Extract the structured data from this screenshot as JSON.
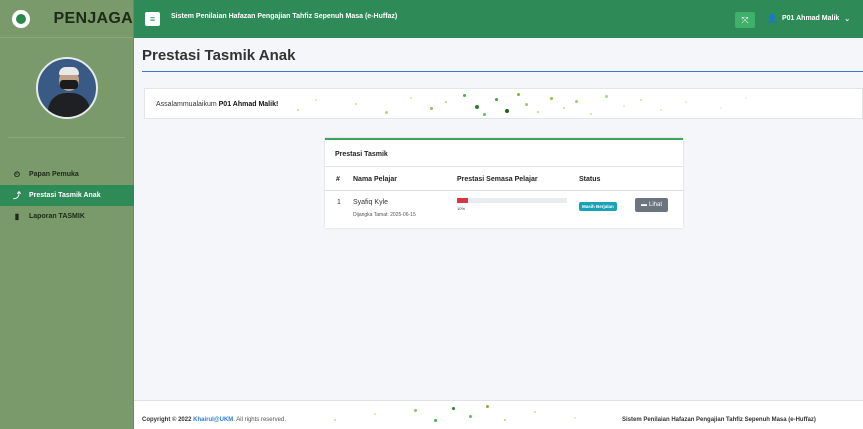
{
  "brand": {
    "name": "PENJAGA"
  },
  "sidebar": {
    "items": [
      {
        "label": "Papan Pemuka",
        "icon": "tachometer-icon",
        "glyph": "⏲",
        "active": false
      },
      {
        "label": "Prestasi Tasmik Anak",
        "icon": "line-chart-icon",
        "glyph": "⤴",
        "active": true
      },
      {
        "label": "Laporan TASMIK",
        "icon": "book-icon",
        "glyph": "▮",
        "active": false
      }
    ]
  },
  "topbar": {
    "menu_glyph": "≡",
    "system_title": "Sistem Penilaian Hafazan Pengajian Tahfiz Sepenuh Masa (e-Huffaz)",
    "expand_glyph": "⤧",
    "user_glyph": "👤",
    "user_label": "P01 Ahmad Malik",
    "chevron_glyph": "⌄"
  },
  "page": {
    "title": "Prestasi Tasmik Anak"
  },
  "welcome": {
    "prefix": "Assalammualaikum ",
    "name": "P01 Ahmad Malik!"
  },
  "card": {
    "title": "Prestasi Tasmik",
    "columns": [
      "#",
      "Nama Pelajar",
      "Prestasi Semasa Pelajar",
      "Status"
    ],
    "rows": [
      {
        "no": "1",
        "name": "Syafiq Kyle",
        "expected": "Dijangka Tamat: 2025-06-15",
        "progress_percent": 10,
        "progress_label": "10%",
        "status": "Masih Berjalan",
        "action": "Lihat",
        "action_glyph": "▬"
      }
    ]
  },
  "footer": {
    "copyright_prefix": "Copyright © 2022 ",
    "copyright_link": "Khairul@UKM",
    "copyright_suffix": ". All rights reserved.",
    "system_name": "Sistem Penilaian Hafazan Pengajian Tahfiz Sepenuh Masa (e-Huffaz)"
  },
  "colors": {
    "topbar": "#2e8b57",
    "sidebar": "#7a9a6c",
    "active_nav": "#2e8b57",
    "badge": "#17a2b8",
    "progress": "#d9343f",
    "title_rule": "#3b7ac8"
  }
}
